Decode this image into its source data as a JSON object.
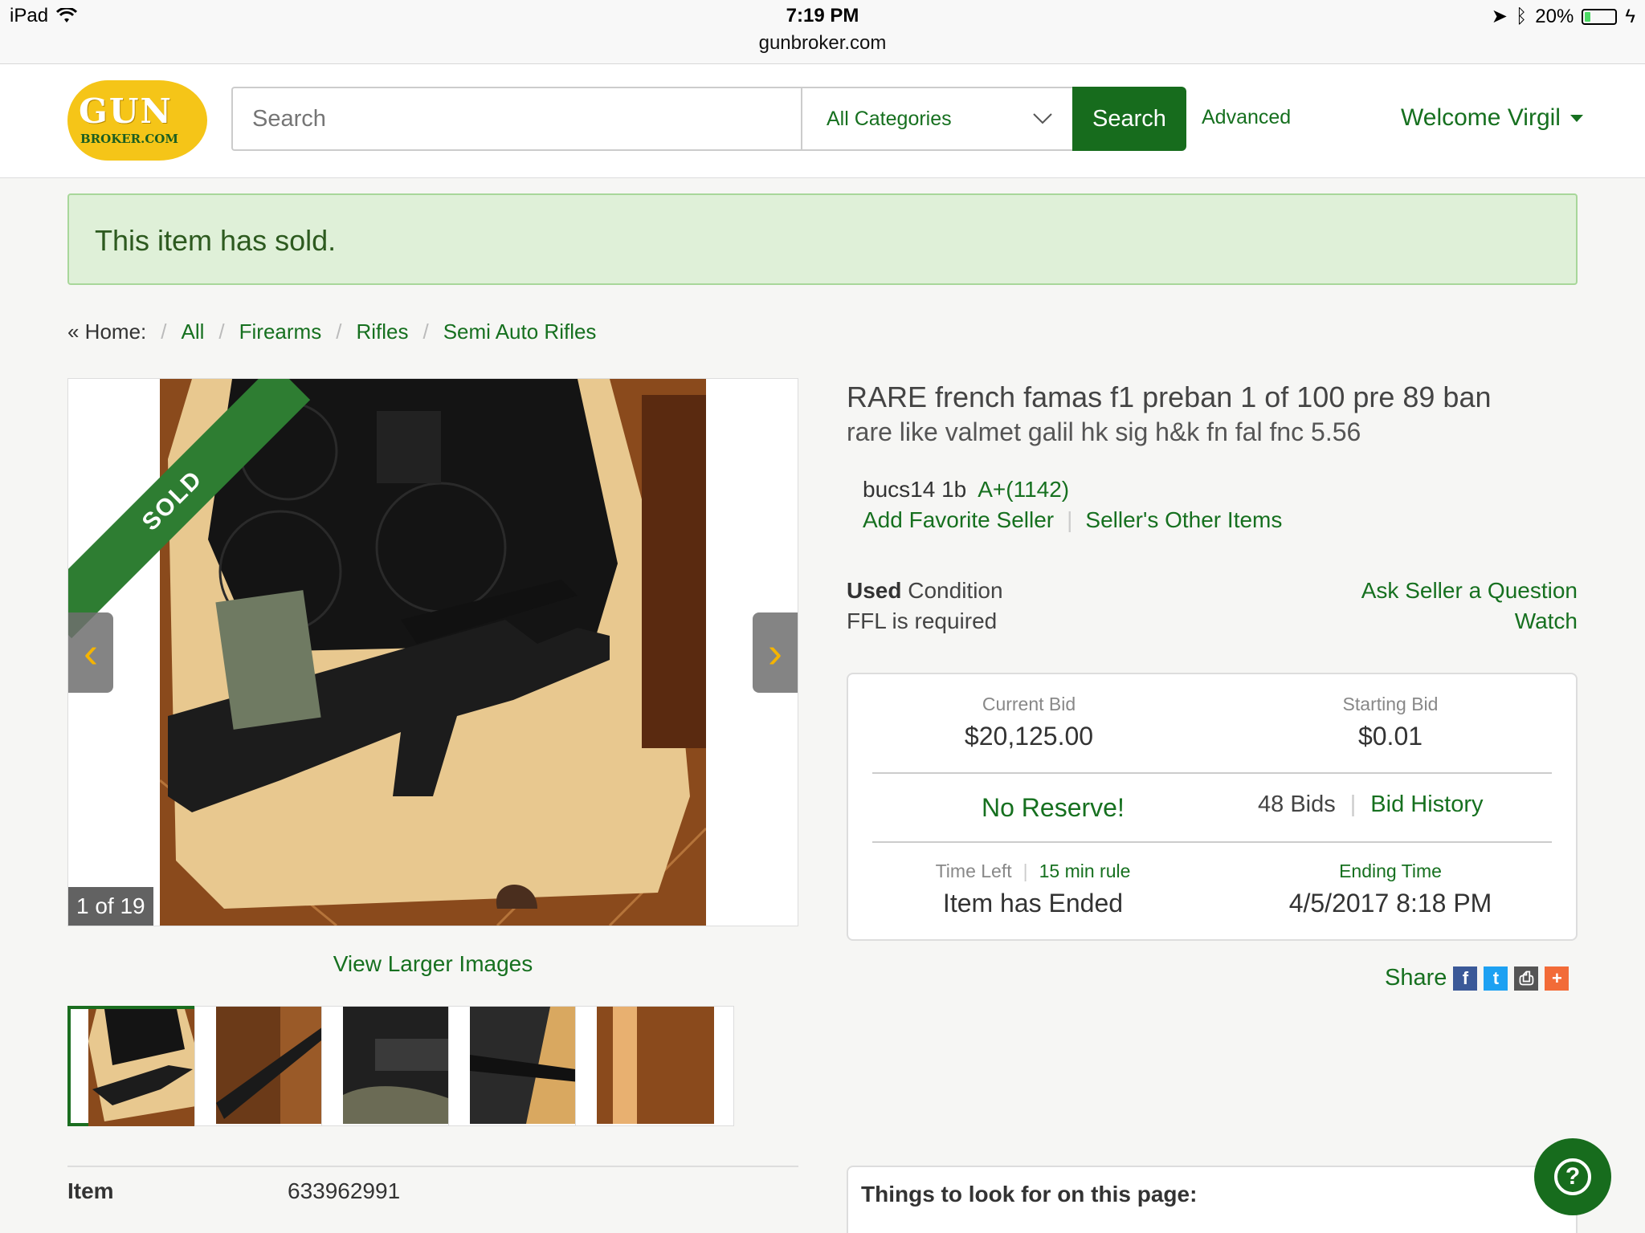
{
  "status_bar": {
    "device": "iPad",
    "time": "7:19 PM",
    "url": "gunbroker.com",
    "battery_text": "20%",
    "battery_level": 0.2
  },
  "header": {
    "logo_gun": "GUN",
    "logo_broker": "BROKER.COM",
    "search_placeholder": "Search",
    "category_selected": "All Categories",
    "search_button": "Search",
    "advanced_link": "Advanced",
    "welcome": "Welcome Virgil"
  },
  "banner": {
    "text": "This item has sold."
  },
  "breadcrumb": {
    "home": "« Home:",
    "items": [
      "All",
      "Firearms",
      "Rifles",
      "Semi Auto Rifles"
    ]
  },
  "gallery": {
    "sold_ribbon": "SOLD",
    "counter": "1 of 19",
    "view_larger": "View Larger Images",
    "prev_glyph": "‹",
    "next_glyph": "›"
  },
  "listing": {
    "title": "RARE french famas f1 preban 1 of 100 pre 89 ban",
    "subtitle": "rare like valmet galil hk sig h&k fn fal fnc 5.56",
    "seller_name": "bucs14 1b",
    "seller_rating": "A+(1142)",
    "add_favorite": "Add Favorite Seller",
    "other_items": "Seller's Other Items",
    "condition_value": "Used",
    "condition_label": "Condition",
    "ffl": "FFL is required",
    "ask_seller": "Ask Seller a Question",
    "watch": "Watch"
  },
  "bid_box": {
    "current_bid_label": "Current Bid",
    "current_bid": "$20,125.00",
    "starting_bid_label": "Starting Bid",
    "starting_bid": "$0.01",
    "no_reserve": "No Reserve!",
    "bids": "48 Bids",
    "bid_history": "Bid History",
    "time_left_label": "Time Left",
    "min_rule": "15 min rule",
    "time_left_value": "Item has Ended",
    "ending_time_label": "Ending Time",
    "ending_time": "4/5/2017 8:18 PM"
  },
  "share": {
    "label": "Share",
    "icons": [
      {
        "name": "facebook-icon",
        "glyph": "f",
        "color": "#3b5998"
      },
      {
        "name": "twitter-icon",
        "glyph": "t",
        "color": "#1da1f2"
      },
      {
        "name": "print-icon",
        "glyph": "⎙",
        "color": "#555555"
      },
      {
        "name": "more-share-icon",
        "glyph": "+",
        "color": "#f26b38"
      }
    ]
  },
  "details": {
    "item_label": "Item",
    "item_value": "633962991"
  },
  "things": {
    "heading": "Things to look for on this page:"
  },
  "help": {
    "glyph": "?"
  },
  "colors": {
    "brand_green": "#16701f",
    "logo_yellow": "#f5c518",
    "banner_bg": "#dff0d8"
  }
}
